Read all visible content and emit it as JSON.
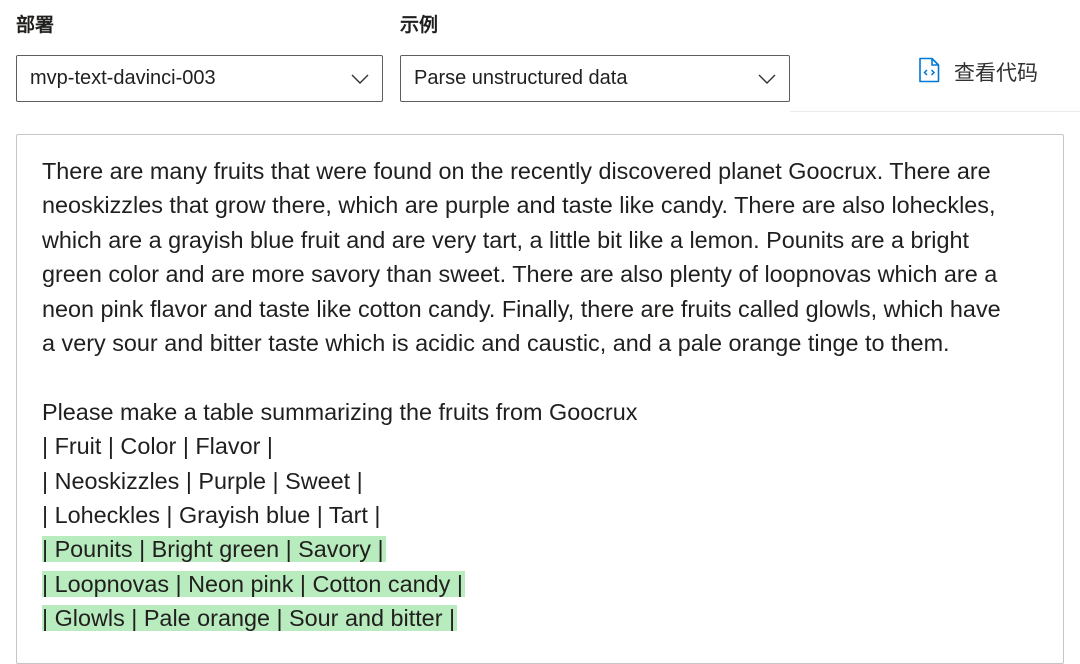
{
  "deployment": {
    "label": "部署",
    "selected": "mvp-text-davinci-003"
  },
  "example": {
    "label": "示例",
    "selected": "Parse unstructured data"
  },
  "view_code": {
    "label": "查看代码"
  },
  "prompt": {
    "lines": [
      "There are many fruits that were found on the recently discovered planet Goocrux. There are",
      "neoskizzles that grow there, which are purple and taste like candy. There are also loheckles,",
      "which are a grayish blue fruit and are very tart, a little bit like a lemon. Pounits are a bright",
      "green color and are more savory than sweet. There are also plenty of loopnovas which are a",
      "neon pink flavor and taste like cotton candy. Finally, there are fruits called glowls, which have",
      "a very sour and bitter taste which is acidic and caustic, and a pale orange tinge to them.",
      "",
      "Please make a table summarizing the fruits from Goocrux",
      "| Fruit | Color | Flavor |",
      "| Neoskizzles | Purple | Sweet |",
      "| Loheckles | Grayish blue | Tart |"
    ],
    "completion_lines": [
      "| Pounits | Bright green | Savory |",
      "| Loopnovas | Neon pink | Cotton candy |",
      "| Glowls | Pale orange | Sour and bitter |"
    ]
  },
  "colors": {
    "completion_highlight": "#b8ebbd",
    "accent": "#0078d4",
    "border": "#605e5c"
  },
  "icons": {
    "dropdown": "chevron-down-icon",
    "view_code": "code-file-icon"
  }
}
